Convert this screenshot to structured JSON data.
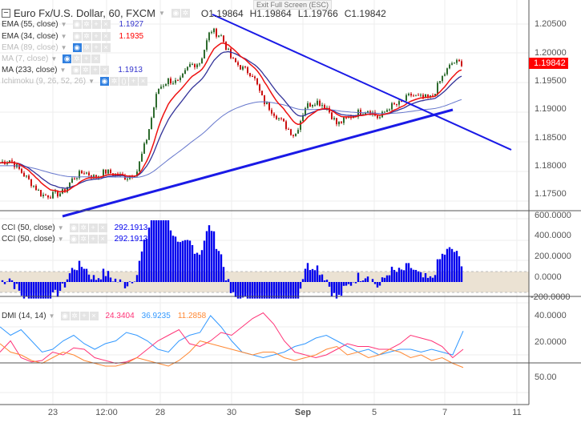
{
  "header": {
    "title": "Euro Fx/U.S. Dollar, 60, FXCM",
    "open": "O1.19864",
    "high": "H1.19864",
    "low": "L1.19766",
    "close": "C1.19842",
    "tooltip": "Exit Full Screen (ESC)"
  },
  "legend": [
    {
      "label": "EMA (55, close)",
      "value": "1.1927",
      "color": "#3333cc"
    },
    {
      "label": "EMA (34, close)",
      "value": "1.1935",
      "color": "#ff0000"
    },
    {
      "label": "EMA (89, close)",
      "value": ""
    },
    {
      "label": "MA (7, close)",
      "value": ""
    },
    {
      "label": "MA (233, close)",
      "value": "1.1913",
      "color": "#3333cc"
    },
    {
      "label": "Ichimoku (9, 26, 52, 26)",
      "value": ""
    }
  ],
  "cci_legend": [
    {
      "label": "CCI (50, close)",
      "value": "292.1913"
    },
    {
      "label": "CCI (50, close)",
      "value": "292.1913"
    }
  ],
  "dmi_legend": {
    "label": "DMI (14, 14)",
    "plus": "24.3404",
    "minus": "36.9235",
    "adx": "11.2858"
  },
  "colors": {
    "up": "#2e6b2e",
    "down": "#cc1111",
    "cci": "#0000ee",
    "ema34": "#ee1111",
    "ema55": "#333399",
    "ma233": "#6677cc",
    "trend": "#1a1ae6",
    "diplus": "#ff3377",
    "diminus": "#3399ff",
    "adx": "#ff8833"
  },
  "price_axis": [
    "1.20500",
    "1.20000",
    "1.19500",
    "1.19000",
    "1.18500",
    "1.18000",
    "1.17500"
  ],
  "last_price": "1.19842",
  "cci_axis": [
    "600.0000",
    "400.0000",
    "200.0000",
    "0.0000",
    "-200.0000"
  ],
  "dmi_axis": [
    "40.0000",
    "20.0000"
  ],
  "bottom_axis": [
    "50.00"
  ],
  "x_labels": [
    "23",
    "12:00",
    "28",
    "30",
    "Sep",
    "5",
    "7",
    "11"
  ],
  "chart_data": {
    "type": "candlestick",
    "price_range": [
      1.1725,
      1.2085
    ],
    "closes": [
      1.1815,
      1.182,
      1.18,
      1.178,
      1.176,
      1.176,
      1.1765,
      1.179,
      1.18,
      1.179,
      1.18,
      1.1795,
      1.179,
      1.18,
      1.186,
      1.194,
      1.1955,
      1.195,
      1.198,
      1.1985,
      1.204,
      1.203,
      1.199,
      1.1975,
      1.1965,
      1.192,
      1.19,
      1.188,
      1.186,
      1.191,
      1.192,
      1.191,
      1.188,
      1.189,
      1.19,
      1.1905,
      1.189,
      1.191,
      1.1915,
      1.193,
      1.1925,
      1.1925,
      1.196,
      1.1985,
      1.1984
    ],
    "dmi_plus": [
      22,
      30,
      18,
      15,
      16,
      22,
      20,
      25,
      24,
      18,
      16,
      14,
      15,
      18,
      24,
      30,
      34,
      38,
      28,
      26,
      30,
      36,
      34,
      40,
      46,
      50,
      42,
      30,
      22,
      20,
      18,
      20,
      24,
      28,
      26,
      26,
      24,
      24,
      28,
      34,
      32,
      30,
      26,
      18,
      24
    ],
    "dmi_minus": [
      40,
      34,
      38,
      30,
      22,
      24,
      30,
      34,
      28,
      24,
      28,
      30,
      36,
      34,
      30,
      24,
      22,
      30,
      34,
      36,
      48,
      40,
      30,
      22,
      20,
      18,
      20,
      22,
      26,
      28,
      32,
      34,
      30,
      26,
      22,
      24,
      20,
      22,
      24,
      24,
      22,
      24,
      22,
      20,
      37
    ],
    "adx": [
      28,
      22,
      20,
      16,
      14,
      18,
      22,
      20,
      16,
      14,
      12,
      12,
      14,
      18,
      16,
      14,
      12,
      16,
      22,
      30,
      28,
      26,
      24,
      22,
      20,
      22,
      22,
      18,
      16,
      18,
      20,
      24,
      26,
      20,
      22,
      18,
      20,
      24,
      22,
      18,
      20,
      16,
      18,
      14,
      11
    ]
  }
}
